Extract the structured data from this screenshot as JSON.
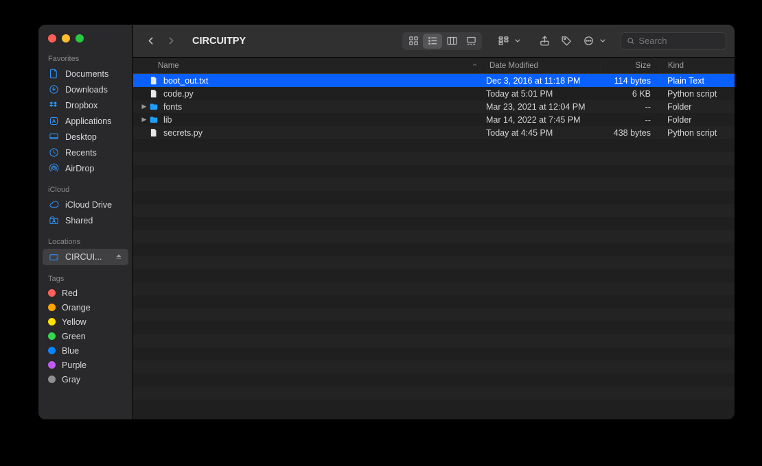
{
  "window": {
    "title": "CIRCUITPY"
  },
  "search": {
    "placeholder": "Search"
  },
  "sidebar": {
    "sections": [
      {
        "label": "Favorites",
        "items": [
          {
            "icon": "doc",
            "label": "Documents"
          },
          {
            "icon": "download",
            "label": "Downloads"
          },
          {
            "icon": "dropbox",
            "label": "Dropbox"
          },
          {
            "icon": "app",
            "label": "Applications"
          },
          {
            "icon": "desktop",
            "label": "Desktop"
          },
          {
            "icon": "clock",
            "label": "Recents"
          },
          {
            "icon": "airdrop",
            "label": "AirDrop"
          }
        ]
      },
      {
        "label": "iCloud",
        "items": [
          {
            "icon": "cloud",
            "label": "iCloud Drive"
          },
          {
            "icon": "shared",
            "label": "Shared"
          }
        ]
      },
      {
        "label": "Locations",
        "items": [
          {
            "icon": "disk",
            "label": "CIRCUI...",
            "eject": true,
            "active": true
          }
        ]
      },
      {
        "label": "Tags",
        "items": [
          {
            "tag": "#ff6159",
            "label": "Red"
          },
          {
            "tag": "#ffa500",
            "label": "Orange"
          },
          {
            "tag": "#ffe100",
            "label": "Yellow"
          },
          {
            "tag": "#32d74b",
            "label": "Green"
          },
          {
            "tag": "#0a84ff",
            "label": "Blue"
          },
          {
            "tag": "#bf5af2",
            "label": "Purple"
          },
          {
            "tag": "#8e8e93",
            "label": "Gray"
          }
        ]
      }
    ]
  },
  "columns": {
    "name": "Name",
    "date": "Date Modified",
    "size": "Size",
    "kind": "Kind"
  },
  "files": [
    {
      "type": "file",
      "name": "boot_out.txt",
      "date": "Dec 3, 2016 at 11:18 PM",
      "size": "114 bytes",
      "kind": "Plain Text",
      "selected": true
    },
    {
      "type": "file",
      "name": "code.py",
      "date": "Today at 5:01 PM",
      "size": "6 KB",
      "kind": "Python script"
    },
    {
      "type": "folder",
      "name": "fonts",
      "date": "Mar 23, 2021 at 12:04 PM",
      "size": "--",
      "kind": "Folder",
      "disclosure": true
    },
    {
      "type": "folder",
      "name": "lib",
      "date": "Mar 14, 2022 at 7:45 PM",
      "size": "--",
      "kind": "Folder",
      "disclosure": true
    },
    {
      "type": "file",
      "name": "secrets.py",
      "date": "Today at 4:45 PM",
      "size": "438 bytes",
      "kind": "Python script"
    }
  ],
  "empty_rows": 21
}
